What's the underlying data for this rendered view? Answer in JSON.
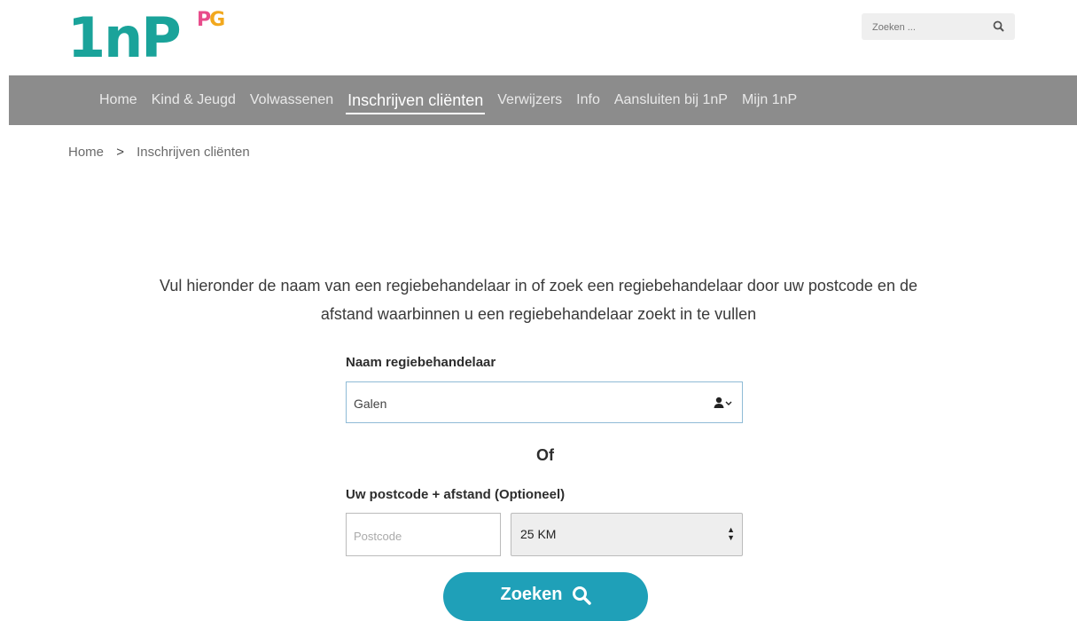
{
  "logo": {
    "text": "1nP",
    "sup_p": "P",
    "sup_g": "G"
  },
  "search": {
    "placeholder": "Zoeken ..."
  },
  "nav": {
    "items": [
      {
        "label": "Home"
      },
      {
        "label": "Kind & Jeugd"
      },
      {
        "label": "Volwassenen"
      },
      {
        "label": "Inschrijven cliënten"
      },
      {
        "label": "Verwijzers"
      },
      {
        "label": "Info"
      },
      {
        "label": "Aansluiten bij 1nP"
      },
      {
        "label": "Mijn 1nP"
      }
    ]
  },
  "breadcrumb": {
    "home": "Home",
    "sep": ">",
    "current": "Inschrijven cliënten"
  },
  "intro": {
    "line1": "Vul hieronder de naam van een regiebehandelaar in of zoek een regiebehandelaar door uw postcode en de",
    "line2": "afstand waarbinnen u een regiebehandelaar zoekt in te vullen"
  },
  "form": {
    "name_label": "Naam regiebehandelaar",
    "name_value": "Galen",
    "or_label": "Of",
    "postcode_label": "Uw postcode + afstand (Optioneel)",
    "postcode_placeholder": "Postcode",
    "distance_value": "25 KM",
    "submit_label": "Zoeken"
  },
  "colors": {
    "teal": "#1aa39a",
    "nav_bg": "#8c8c8c",
    "button": "#1fa0b8"
  }
}
